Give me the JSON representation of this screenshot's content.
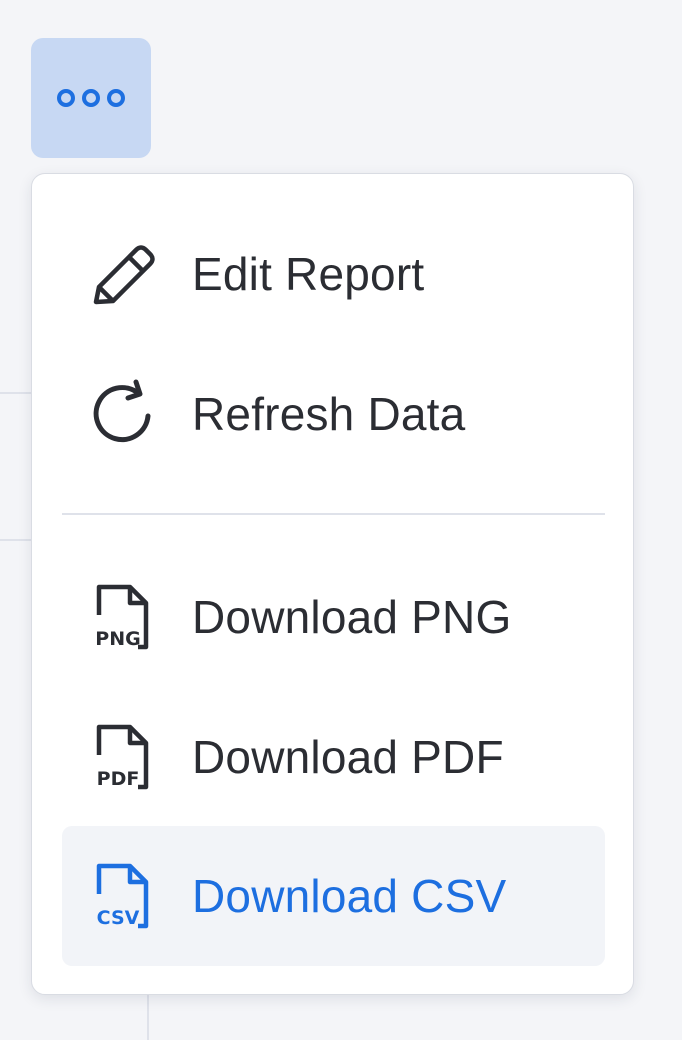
{
  "more_button": {
    "icon": "more-horizontal-icon"
  },
  "menu": {
    "items": [
      {
        "label": "Edit Report",
        "icon": "pencil-icon"
      },
      {
        "label": "Refresh Data",
        "icon": "refresh-icon"
      },
      {
        "label": "Download PNG",
        "icon": "file-png-icon",
        "icon_text": "PNG"
      },
      {
        "label": "Download PDF",
        "icon": "file-pdf-icon",
        "icon_text": "PDF"
      },
      {
        "label": "Download CSV",
        "icon": "file-csv-icon",
        "icon_text": "CSV",
        "active": true
      }
    ]
  },
  "colors": {
    "accent": "#1d6fe0",
    "text": "#2b2d33",
    "button_bg": "#c7d8f3",
    "hover_bg": "#f2f4f8"
  }
}
